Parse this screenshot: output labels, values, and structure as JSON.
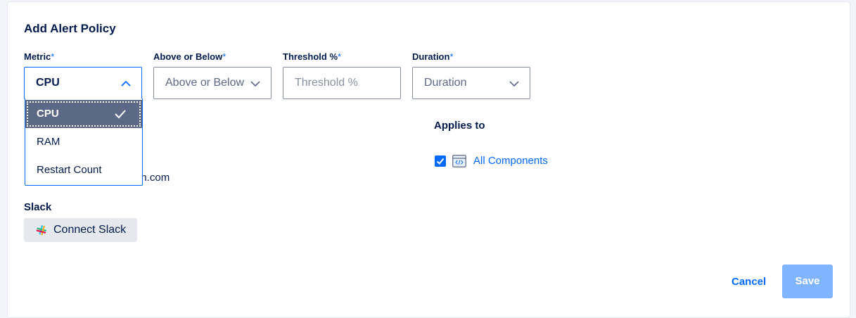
{
  "dialog": {
    "title": "Add Alert Policy"
  },
  "fields": {
    "metric": {
      "label": "Metric",
      "required_mark": "*",
      "value": "CPU"
    },
    "above_below": {
      "label": "Above or Below",
      "required_mark": "*",
      "value": "Above or Below"
    },
    "threshold": {
      "label": "Threshold %",
      "required_mark": "*",
      "placeholder": "Threshold %"
    },
    "duration": {
      "label": "Duration",
      "required_mark": "*",
      "value": "Duration"
    }
  },
  "metric_dropdown": {
    "options": [
      "CPU",
      "RAM",
      "Restart Count"
    ],
    "selected": "CPU"
  },
  "partial_email_text": "an.com",
  "slack": {
    "label": "Slack",
    "button_label": "Connect Slack"
  },
  "applies_to": {
    "label": "Applies to",
    "checked": true,
    "component_label": "All Components"
  },
  "actions": {
    "cancel_label": "Cancel",
    "save_label": "Save"
  },
  "colors": {
    "accent": "#0069ff",
    "text": "#031b4e",
    "selected_option_bg": "#5b6987",
    "save_disabled": "#80b4ff"
  },
  "icons": {
    "select_chevron": "chevron-down-icon",
    "open_chevron": "chevron-up-icon",
    "selected_check": "check-icon",
    "slack": "slack-icon",
    "component": "code-window-icon"
  }
}
